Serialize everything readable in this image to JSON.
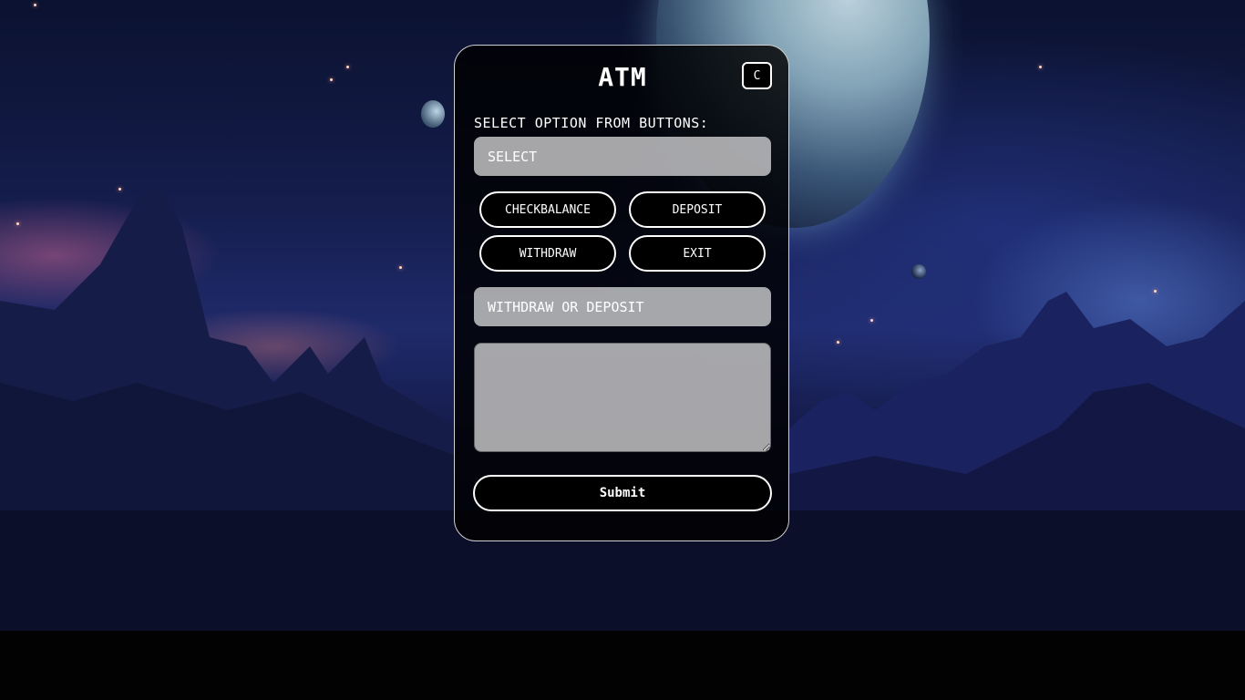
{
  "atm": {
    "title": "ATM",
    "close_label": "C",
    "select_prompt": "SELECT OPTION FROM BUTTONS:",
    "select_field": {
      "value": "SELECT"
    },
    "buttons": {
      "checkbalance": "CHECKBALANCE",
      "deposit": "DEPOSIT",
      "withdraw": "WITHDRAW",
      "exit": "EXIT"
    },
    "amount_field": {
      "placeholder": "WITHDRAW OR DEPOSIT",
      "value": ""
    },
    "output_area": {
      "value": ""
    },
    "submit_label": "Submit"
  },
  "colors": {
    "panel_bg": "#000000",
    "field_bg": "#c3c3c5",
    "text": "#ffffff",
    "border": "#ffffff"
  }
}
